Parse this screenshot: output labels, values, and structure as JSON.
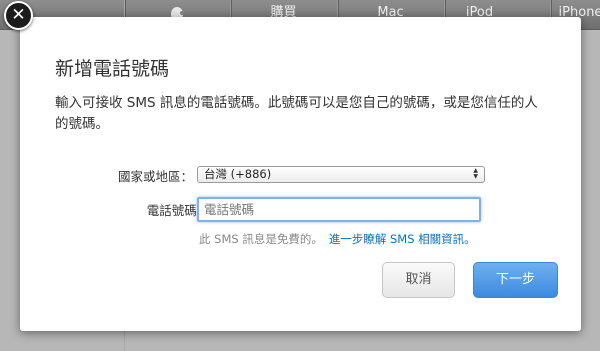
{
  "background_nav": {
    "items": [
      "購買",
      "Mac",
      "iPod",
      "iPhone"
    ]
  },
  "dialog": {
    "title": "新增電話號碼",
    "description": "輸入可接收 SMS 訊息的電話號碼。此號碼可以是您自己的號碼，或是您信任的人的號碼。",
    "country_label": "國家或地區：",
    "country_value": "台灣 (+886)",
    "phone_label": "電話號碼:",
    "phone_placeholder": "電話號碼",
    "note_text": "此 SMS 訊息是免費的。",
    "note_link": "進一步瞭解 SMS 相關資訊。",
    "cancel_label": "取消",
    "next_label": "下一步"
  },
  "colors": {
    "primary_button": "#3c8ae0",
    "link": "#0a6fc2",
    "focus_ring": "#7fb2e6"
  }
}
